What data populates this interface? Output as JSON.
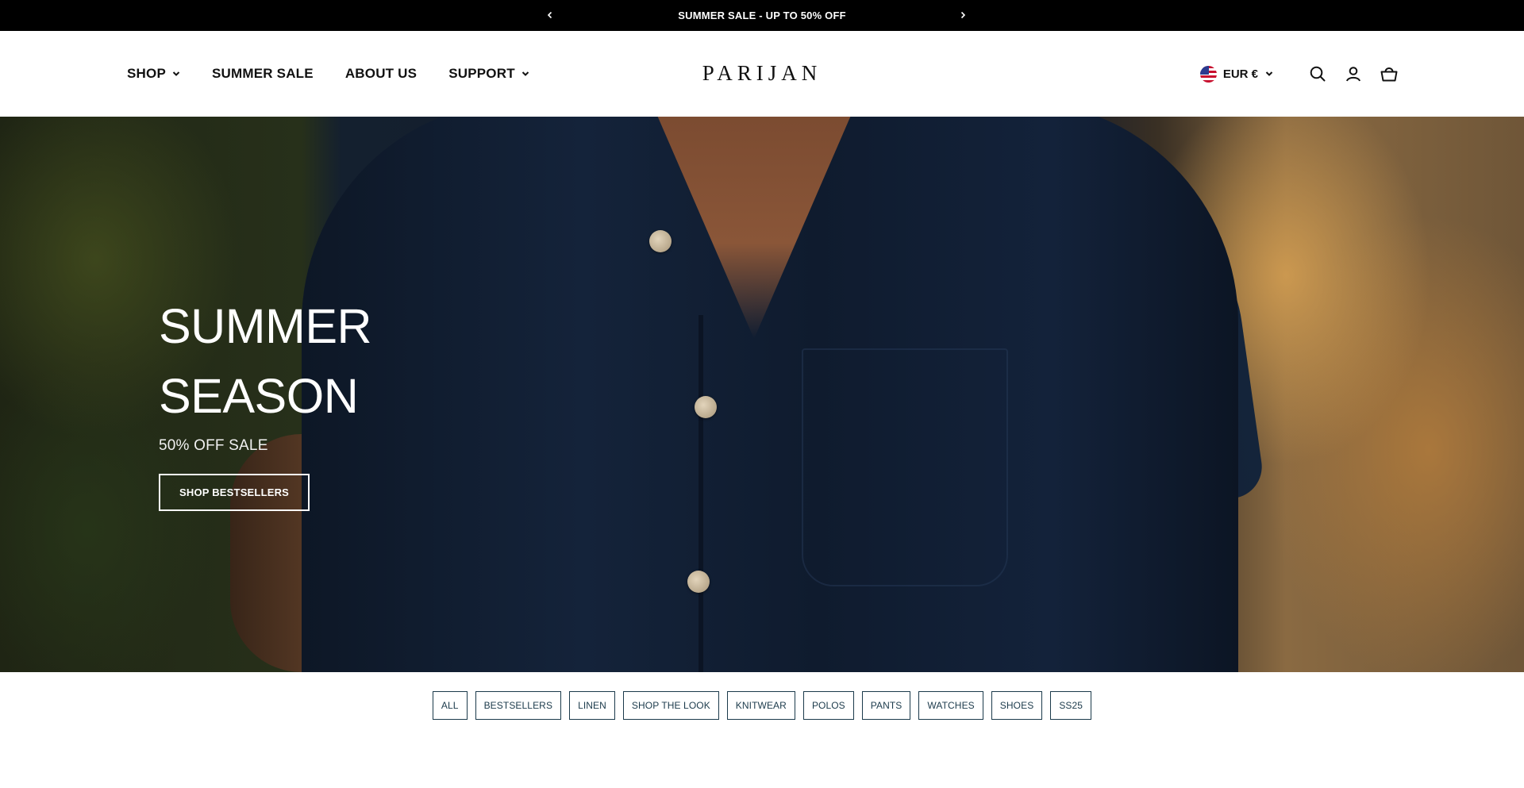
{
  "announcement": {
    "text": "SUMMER SALE - UP TO 50% OFF",
    "prev_icon": "chevron-left-icon",
    "next_icon": "chevron-right-icon"
  },
  "header": {
    "nav": [
      {
        "label": "SHOP",
        "has_dropdown": true
      },
      {
        "label": "SUMMER SALE",
        "has_dropdown": false
      },
      {
        "label": "ABOUT US",
        "has_dropdown": false
      },
      {
        "label": "SUPPORT",
        "has_dropdown": true
      }
    ],
    "logo": "PARIJAN",
    "currency": {
      "label": "EUR €",
      "flag": "us-flag-icon"
    },
    "icons": [
      "search-icon",
      "account-icon",
      "cart-icon"
    ]
  },
  "hero": {
    "title_line1": "SUMMER",
    "title_line2": "SEASON",
    "subtitle": "50% OFF SALE",
    "cta_label": "SHOP BESTSELLERS"
  },
  "filters": [
    "ALL",
    "BESTSELLERS",
    "LINEN",
    "SHOP THE LOOK",
    "KNITWEAR",
    "POLOS",
    "PANTS",
    "WATCHES",
    "SHOES",
    "SS25"
  ],
  "colors": {
    "announcement_bg": "#000000",
    "text": "#111111",
    "chip_border": "#1b3a4b",
    "hero_shirt": "#14233a"
  }
}
